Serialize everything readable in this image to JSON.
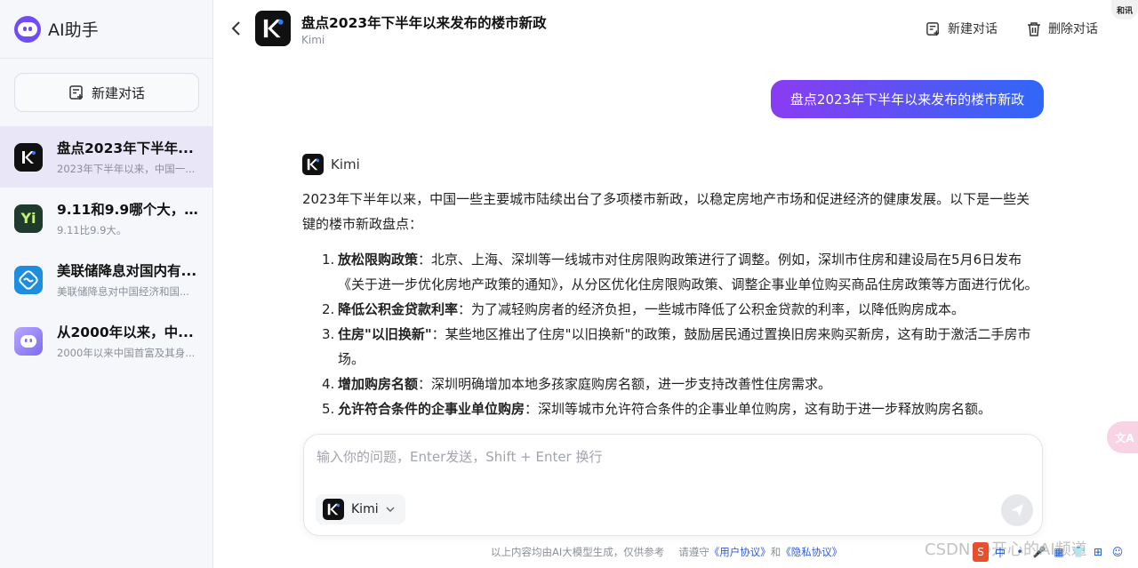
{
  "sidebar": {
    "brand": "AI助手",
    "new_chat": "新建对话",
    "conversations": [
      {
        "title": "盘点2023年下半年...",
        "subtitle": "2023年下半年以来，中国一...",
        "icon": "kimi-logo-icon",
        "icon_bg": "#111111",
        "glyph": "K"
      },
      {
        "title": "9.11和9.9哪个大，...",
        "subtitle": "9.11比9.9大。",
        "icon": "yi-logo-icon",
        "icon_bg": "#1f3b2d",
        "glyph": "Yi"
      },
      {
        "title": "美联储降息对国内有...",
        "subtitle": "美联储降息对中国经济和国...",
        "icon": "wave-logo-icon",
        "icon_bg": "#1d8de0",
        "glyph": "≋"
      },
      {
        "title": "从2000年以来，中...",
        "subtitle": "2000年以来中国首富及其身...",
        "icon": "robot-logo-icon",
        "icon_bg": "#9a8cf0",
        "glyph": "•"
      }
    ]
  },
  "header": {
    "title": "盘点2023年下半年以来发布的楼市新政",
    "subtitle": "Kimi",
    "new_chat": "新建对话",
    "delete_chat": "删除对话",
    "corner_badge": "和讯"
  },
  "chat": {
    "user_message": "盘点2023年下半年以来发布的楼市新政",
    "ai_name": "Kimi",
    "intro": "2023年下半年以来，中国一些主要城市陆续出台了多项楼市新政，以稳定房地产市场和促进经济的健康发展。以下是一些关键的楼市新政盘点：",
    "items": [
      {
        "num": "1.",
        "bold": "放松限购政策",
        "text": "：北京、上海、深圳等一线城市对住房限购政策进行了调整。例如，深圳市住房和建设局在5月6日发布《关于进一步优化房地产政策的通知》，从分区优化住房限购政策、调整企事业单位购买商品住房政策等方面进行优化。"
      },
      {
        "num": "2.",
        "bold": "降低公积金贷款利率",
        "text": "：为了减轻购房者的经济负担，一些城市降低了公积金贷款的利率，以降低购房成本。"
      },
      {
        "num": "3.",
        "bold": "住房\"以旧换新\"",
        "text": "：某些地区推出了住房\"以旧换新\"的政策，鼓励居民通过置换旧房来购买新房，这有助于激活二手房市场。"
      },
      {
        "num": "4.",
        "bold": "增加购房名额",
        "text": "：深圳明确增加本地多孩家庭购房名额，进一步支持改善性住房需求。"
      },
      {
        "num": "5.",
        "bold": "允许符合条件的企事业单位购房",
        "text": "：深圳等城市允许符合条件的企事业单位购房，这有助于进一步释放购房名额。"
      }
    ]
  },
  "input": {
    "placeholder": "输入你的问题，Enter发送，Shift + Enter 换行",
    "model": "Kimi"
  },
  "footer": {
    "notice": "以上内容均由AI大模型生成，仅供参考",
    "agree_prefix": "请遵守",
    "user_agreement": "《用户协议》",
    "and": "和",
    "privacy": "《隐私协议》"
  },
  "overlay": {
    "translate": "文A",
    "watermark": "CSDN @开心的AI频道",
    "tray": [
      "S",
      "中",
      "•",
      "🎤",
      "▦",
      "👕",
      "⊞",
      "☺"
    ]
  }
}
